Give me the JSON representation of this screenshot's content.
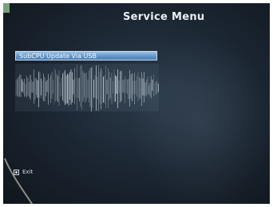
{
  "screen": {
    "title": "Service Menu",
    "selected_item": "SubCPU Update Via USB",
    "exit_label": "Exit"
  },
  "colors": {
    "screen_bg": "#1a2430",
    "highlight": "#5f93c7",
    "text": "#e9eef3",
    "frame_accent": "#7aa07a"
  },
  "icons": {
    "exit_key": "remote-button-icon"
  }
}
